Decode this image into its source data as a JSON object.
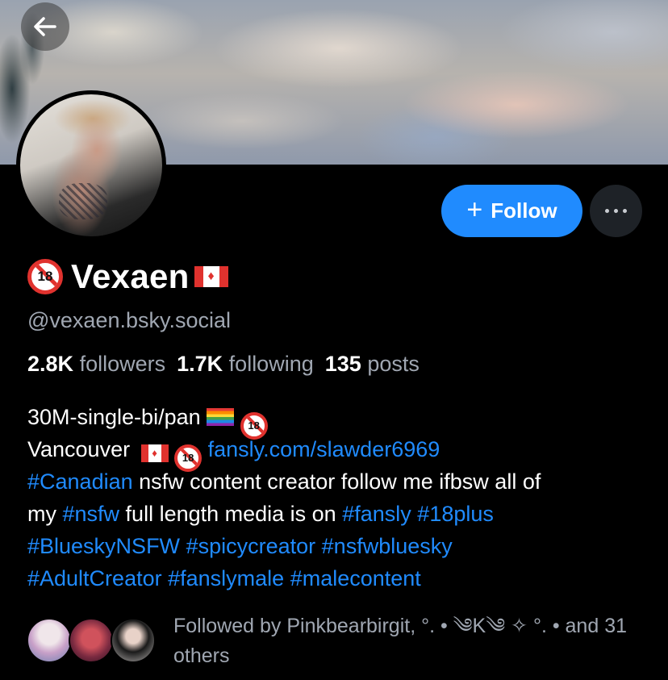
{
  "banner": {
    "back_icon": "arrow-left-icon"
  },
  "actions": {
    "follow_plus": "+",
    "follow_label": "Follow",
    "more_icon": "ellipsis-icon"
  },
  "profile": {
    "display_name": "Vexaen",
    "name_prefix_icon": "no-under-18-icon",
    "name_suffix_icon": "canada-flag-icon",
    "handle": "@vexaen.bsky.social"
  },
  "stats": {
    "followers_count": "2.8K",
    "followers_label": "followers",
    "following_count": "1.7K",
    "following_label": "following",
    "posts_count": "135",
    "posts_label": "posts"
  },
  "bio": {
    "line1_text": "30M-single-bi/pan",
    "line2_text": "Vancouver",
    "line2_link": "fansly.com/slawder6969",
    "line3_tag": "#Canadian",
    "line3_text": " nsfw content creator follow me ifbsw all of",
    "line4_text1": "my ",
    "line4_tag1": "#nsfw",
    "line4_text2": " full length media is on ",
    "line4_tag2": "#fansly",
    "line4_tag3": "#18plus",
    "line5_tag1": "#BlueskyNSFW",
    "line5_tag2": "#spicycreator",
    "line5_tag3": "#nsfwbluesky",
    "line6_tag1": "#AdultCreator",
    "line6_tag2": "#fanslymale",
    "line6_tag3": "#malecontent"
  },
  "followed_by": {
    "text": "Followed by Pinkbearbirgit, °. • ༄K༄ ✧ °. • and 31 others"
  },
  "colors": {
    "accent": "#208bfe",
    "background": "#000000",
    "muted_text": "#a0a7b2",
    "more_button_bg": "#1e2227"
  }
}
